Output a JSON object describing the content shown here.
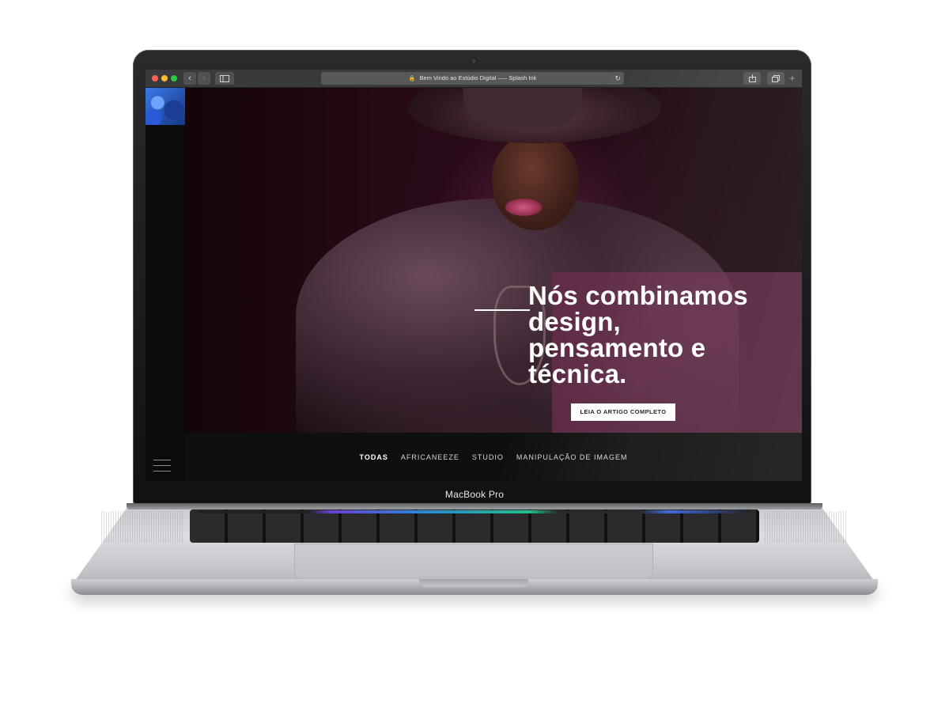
{
  "browser": {
    "url_title": "Bem Vindo ao Estúdio Digital —– Splash Ink",
    "back_icon": "‹",
    "forward_icon": "›",
    "new_tab_icon": "+"
  },
  "hero": {
    "headline": [
      "Nós combinamos",
      "design,",
      "pensamento e",
      "técnica."
    ],
    "cta_label": "LEIA O ARTIGO COMPLETO",
    "panel_color": "#6a2b4c"
  },
  "categories": [
    "TODAS",
    "AFRICANEEZE",
    "STUDIO",
    "MANIPULAÇÃO DE IMAGEM"
  ],
  "active_category": "TODAS",
  "device": {
    "label": "MacBook Pro"
  },
  "icons": {
    "traffic_lights": [
      "close-icon",
      "minimize-icon",
      "zoom-icon"
    ],
    "toolbar": [
      "back-icon",
      "forward-icon",
      "sidebar-icon",
      "lock-icon",
      "reload-icon",
      "share-icon",
      "tabs-icon",
      "new-tab-icon"
    ],
    "menu": "hamburger-icon"
  }
}
